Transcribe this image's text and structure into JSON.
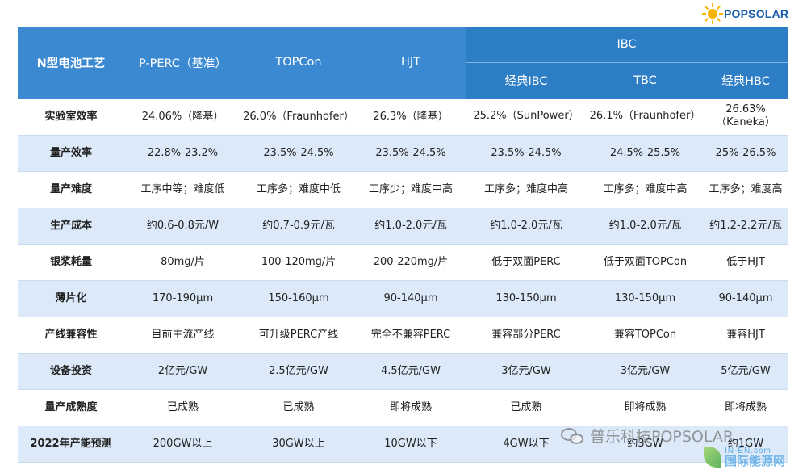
{
  "logo": {
    "text": "POPSOLAR"
  },
  "table": {
    "header_top": {
      "process": "N型电池工艺",
      "p_perc": "P-PERC（基准）",
      "topcon": "TOPCon",
      "hjt": "HJT",
      "ibc_group": "IBC"
    },
    "header_sub": [
      "经典IBC",
      "TBC",
      "经典HBC"
    ],
    "rows": [
      {
        "label": "实验室效率",
        "cells": [
          "24.06%（隆基）",
          "26.0%（Fraunhofer）",
          "26.3%（隆基）",
          "25.2%（SunPower）",
          "26.1%（Fraunhofer）",
          "26.63%（Kaneka）"
        ]
      },
      {
        "label": "量产效率",
        "cells": [
          "22.8%-23.2%",
          "23.5%-24.5%",
          "23.5%-24.5%",
          "23.5%-24.5%",
          "24.5%-25.5%",
          "25%-26.5%"
        ]
      },
      {
        "label": "量产难度",
        "cells": [
          "工序中等；难度低",
          "工序多；难度中低",
          "工序少；难度中高",
          "工序多；难度中高",
          "工序多；难度中高",
          "工序多；难度高"
        ]
      },
      {
        "label": "生产成本",
        "cells": [
          "约0.6-0.8元/W",
          "约0.7-0.9元/瓦",
          "约1.0-2.0元/瓦",
          "约1.0-2.0元/瓦",
          "约1.0-2.0元/瓦",
          "约1.2-2.2元/瓦"
        ]
      },
      {
        "label": "银浆耗量",
        "cells": [
          "80mg/片",
          "100-120mg/片",
          "200-220mg/片",
          "低于双面PERC",
          "低于双面TOPCon",
          "低于HJT"
        ]
      },
      {
        "label": "薄片化",
        "cells": [
          "170-190μm",
          "150-160μm",
          "90-140μm",
          "130-150μm",
          "130-150μm",
          "90-140μm"
        ]
      },
      {
        "label": "产线兼容性",
        "cells": [
          "目前主流产线",
          "可升级PERC产线",
          "完全不兼容PERC",
          "兼容部分PERC",
          "兼容TOPCon",
          "兼容HJT"
        ]
      },
      {
        "label": "设备投资",
        "cells": [
          "2亿元/GW",
          "2.5亿元/GW",
          "4.5亿元/GW",
          "3亿元/GW",
          "3亿元/GW",
          "5亿元/GW"
        ]
      },
      {
        "label": "量产成熟度",
        "cells": [
          "已成熟",
          "已成熟",
          "即将成熟",
          "已成熟",
          "即将成熟",
          "即将成熟"
        ]
      },
      {
        "label": "2022年产能预测",
        "cells": [
          "200GW以上",
          "30GW以上",
          "10GW以下",
          "4GW以下",
          "约3GW",
          "约1GW"
        ]
      }
    ]
  },
  "watermarks": {
    "wechat": "普乐科技POPSOLAR",
    "site_url": "IN-EN.com",
    "site_name": "国际能源网"
  },
  "colors": {
    "header_blue": "#3b8ad1",
    "row_alt": "#dbe9f8",
    "logo_blue": "#1a5fa8",
    "sun_yellow": "#f7b500"
  }
}
